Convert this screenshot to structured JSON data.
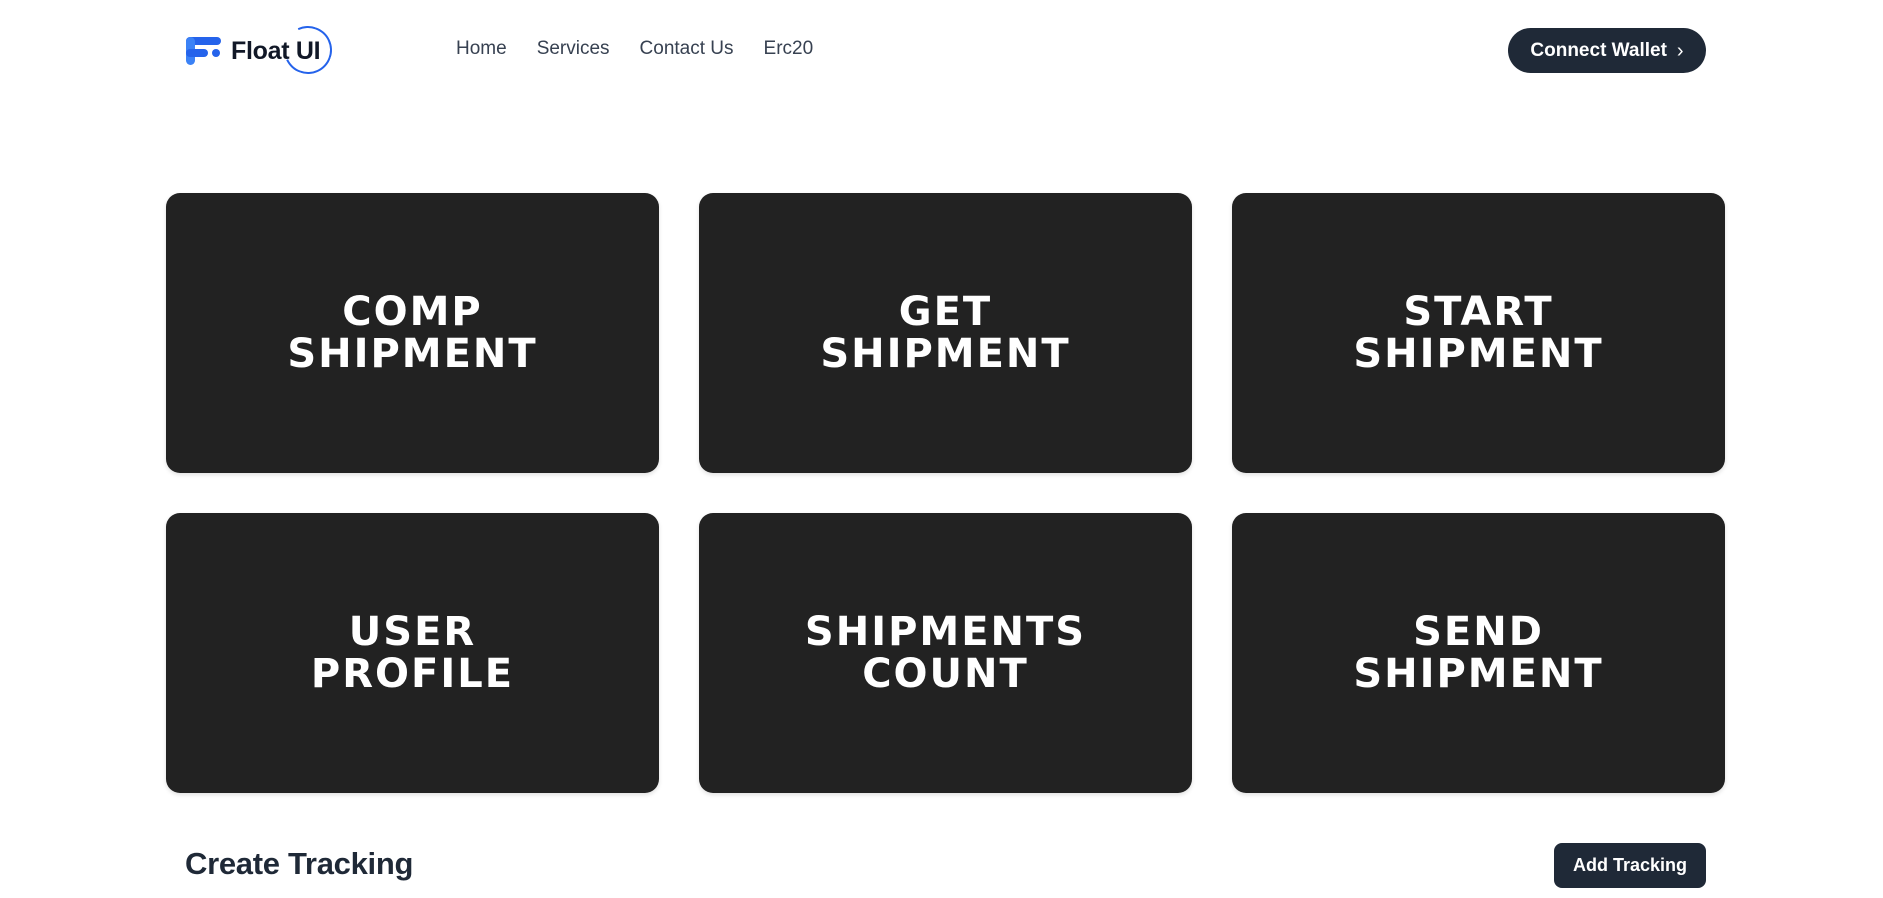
{
  "header": {
    "logo_text": "Float UI",
    "nav": [
      "Home",
      "Services",
      "Contact Us",
      "Erc20"
    ],
    "connect_label": "Connect Wallet",
    "connect_icon": "chevron-right-icon"
  },
  "cards": [
    "COMP\nSHIPMENT",
    "GET\nSHIPMENT",
    "START\nSHIPMENT",
    "USER\nPROFILE",
    "SHIPMENTS\nCOUNT",
    "SEND\nSHIPMENT"
  ],
  "tracking": {
    "title": "Create Tracking",
    "add_label": "Add Tracking"
  },
  "colors": {
    "brand": "#2563eb",
    "dark_button": "#1f2937",
    "card_bg": "#222222"
  }
}
